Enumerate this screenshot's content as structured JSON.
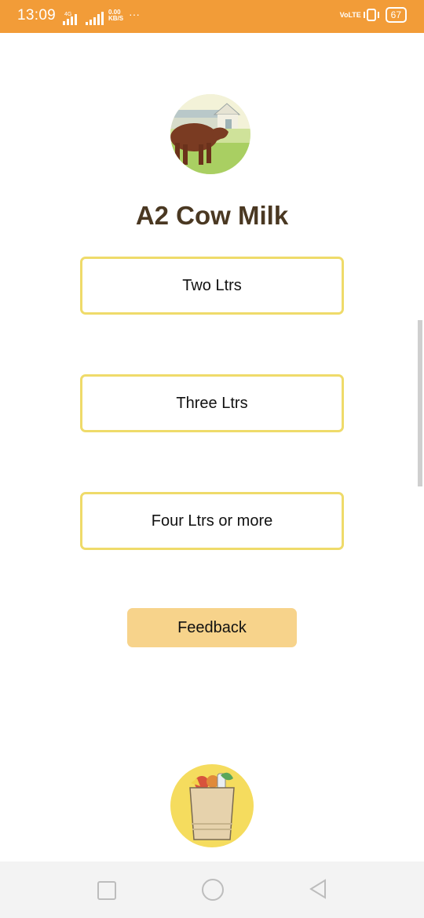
{
  "status_bar": {
    "time": "13:09",
    "network_type": "4G",
    "data_speed": "0.00\nKB/S",
    "more": "···",
    "volte": "VoLTE",
    "battery": "67"
  },
  "header": {
    "logo_icon": "cow-farm-icon",
    "title": "A2 Cow Milk"
  },
  "options": [
    {
      "label": "Two Ltrs"
    },
    {
      "label": "Three Ltrs"
    },
    {
      "label": "Four Ltrs or more"
    }
  ],
  "feedback": {
    "label": "Feedback"
  },
  "footer": {
    "logo_icon": "grocery-bag-icon"
  },
  "colors": {
    "status_bar": "#F29C38",
    "title": "#4a3822",
    "option_border": "#EFDB6A",
    "feedback_bg": "#F7D38B",
    "bag_circle": "#F5DC5E"
  },
  "nav_bar": {
    "icons": [
      "recents-square-icon",
      "home-circle-icon",
      "back-triangle-icon"
    ]
  }
}
